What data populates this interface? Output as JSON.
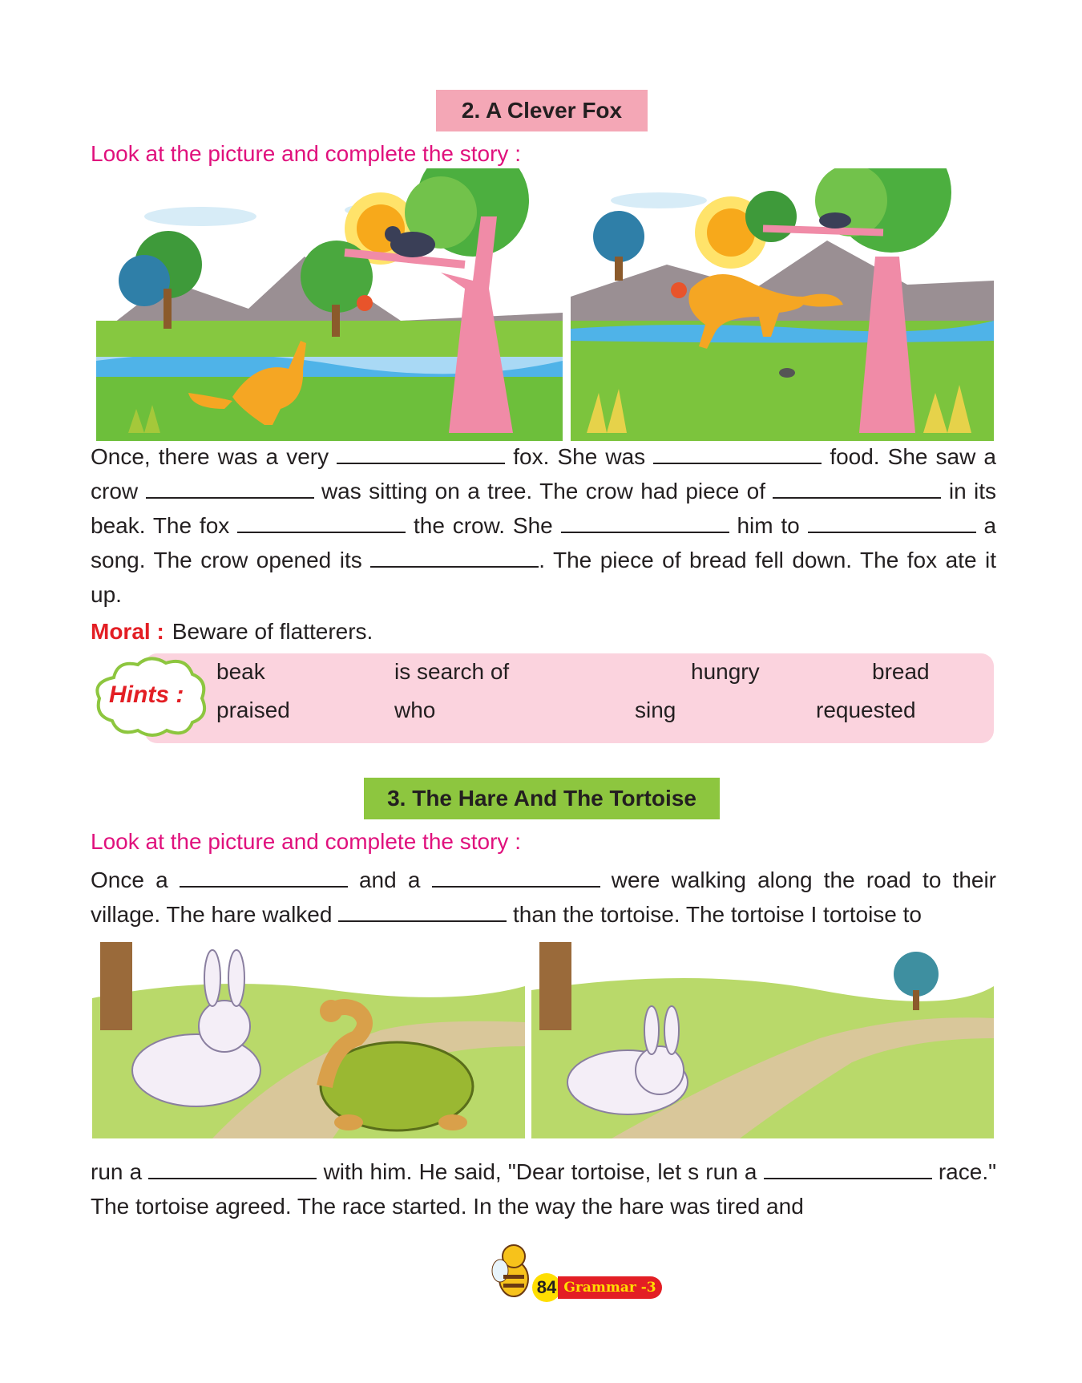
{
  "section_fox": {
    "title": "2. A Clever Fox",
    "instruction": "Look at the picture and complete the story :",
    "story": {
      "p1": "Once, there was a very",
      "p2": "fox. She was",
      "p3": "food. She saw a crow",
      "p4": "was sitting on a tree. The crow had piece of",
      "p5": "in its beak. The fox",
      "p6": "the crow. She",
      "p7": "him to",
      "p8": "a song. The crow opened its",
      "p9": ". The piece of bread fell down. The fox ate it up."
    },
    "moral_label": "Moral :",
    "moral_text": "Beware of flatterers.",
    "hints_label": "Hints :",
    "hints": [
      "beak",
      "is search of",
      "hungry",
      "bread",
      "praised",
      "who",
      "sing",
      "requested"
    ]
  },
  "section_hare": {
    "title": "3. The Hare And The Tortoise",
    "instruction": "Look at the picture and complete the story :",
    "story_top": {
      "p1": "Once a",
      "p2": "and a",
      "p3": "were walking along the road to their village. The hare walked",
      "p4": "than the tortoise. The tortoise I tortoise to"
    },
    "story_bottom": {
      "p1": "run a",
      "p2": "with him. He said, \"Dear tortoise, let s run a",
      "p3": "race.\" The tortoise agreed. The race started. In the way the hare was tired and"
    }
  },
  "footer": {
    "page_number": "84",
    "book_label": "Grammar -3"
  },
  "colors": {
    "fox_title_bg": "#f4a7b6",
    "hare_title_bg": "#8dc63f",
    "instruction": "#e0117d",
    "moral_label": "#e31e24",
    "hints_bg": "#fbd3de"
  }
}
